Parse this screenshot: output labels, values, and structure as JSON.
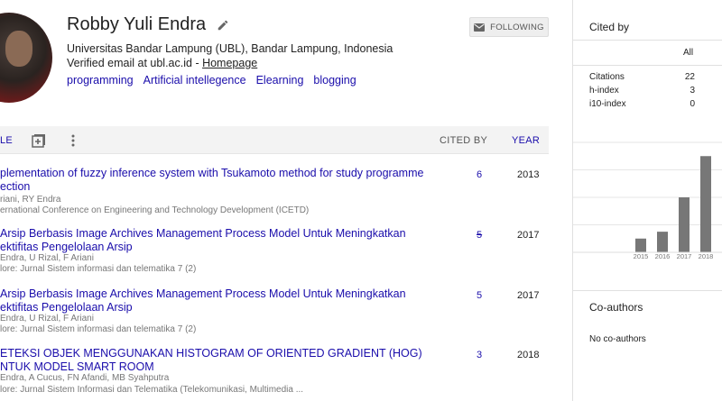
{
  "profile": {
    "name": "Robby Yuli Endra",
    "affiliation": "Universitas Bandar Lampung (UBL), Bandar Lampung, Indonesia",
    "email_text": "Verified email at ubl.ac.id - ",
    "homepage_label": "Homepage",
    "interests": [
      "programming",
      "Artificial intellegence",
      "Elearning",
      "blogging"
    ],
    "follow_label": "FOLLOWING"
  },
  "table": {
    "title_header": "LE",
    "cited_by_header": "CITED BY",
    "year_header": "YEAR"
  },
  "articles": [
    {
      "title_l1": "plementation of fuzzy inference system with Tsukamoto method for study programme",
      "title_l2": "ection",
      "authors": "riani, RY Endra",
      "venue": "ernational Conference on Engineering and Technology Development (ICETD)",
      "cited": "6",
      "year": "2013"
    },
    {
      "title_l1": "Arsip Berbasis Image Archives Management Process Model Untuk Meningkatkan",
      "title_l2": "ektifitas Pengelolaan Arsip",
      "authors": "Endra, U Rizal, F Ariani",
      "venue": "lore: Jurnal Sistem informasi dan telematika 7 (2)",
      "cited": "5",
      "year": "2017"
    },
    {
      "title_l1": "Arsip Berbasis Image Archives Management Process Model Untuk Meningkatkan",
      "title_l2": "ektifitas Pengelolaan Arsip",
      "authors": "Endra, U Rizal, F Ariani",
      "venue": "lore: Jurnal Sistem informasi dan telematika 7 (2)",
      "cited": "5",
      "year": "2017"
    },
    {
      "title_l1": "ETEKSI OBJEK MENGGUNAKAN HISTOGRAM OF ORIENTED GRADIENT (HOG)",
      "title_l2": "NTUK MODEL SMART ROOM",
      "authors": "Endra, A Cucus, FN Afandi, MB Syahputra",
      "venue": "lore: Jurnal Sistem Informasi dan Telematika (Telekomunikasi, Multimedia ...",
      "cited": "3",
      "year": "2018"
    }
  ],
  "cited_by": {
    "title": "Cited by",
    "column_all": "All",
    "stats": [
      {
        "label": "Citations",
        "value": "22"
      },
      {
        "label": "h-index",
        "value": "3"
      },
      {
        "label": "i10-index",
        "value": "0"
      }
    ]
  },
  "chart_data": {
    "type": "bar",
    "categories": [
      "2015",
      "2016",
      "2017",
      "2018"
    ],
    "values": [
      2,
      3,
      8,
      14
    ],
    "ylim": [
      0,
      16
    ],
    "bar_color": "#777777",
    "grid": true
  },
  "coauthors": {
    "title": "Co-authors",
    "empty_text": "No co-authors"
  }
}
